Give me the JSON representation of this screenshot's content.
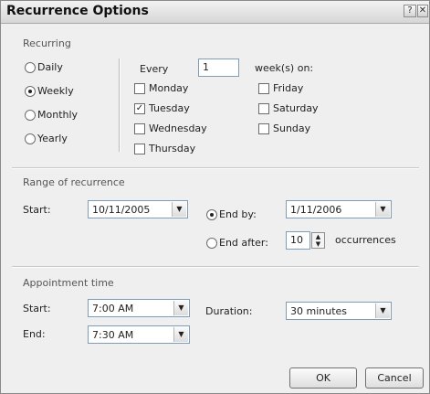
{
  "window": {
    "title": "Recurrence Options",
    "help_glyph": "?",
    "close_glyph": "✕"
  },
  "recurring": {
    "group_label": "Recurring",
    "patterns": [
      {
        "label": "Daily",
        "selected": false
      },
      {
        "label": "Weekly",
        "selected": true
      },
      {
        "label": "Monthly",
        "selected": false
      },
      {
        "label": "Yearly",
        "selected": false
      }
    ],
    "every_label": "Every",
    "every_value": "1",
    "weeks_on_label": "week(s) on:",
    "days": [
      {
        "label": "Monday",
        "checked": false
      },
      {
        "label": "Tuesday",
        "checked": true
      },
      {
        "label": "Wednesday",
        "checked": false
      },
      {
        "label": "Thursday",
        "checked": false
      },
      {
        "label": "Friday",
        "checked": false
      },
      {
        "label": "Saturday",
        "checked": false
      },
      {
        "label": "Sunday",
        "checked": false
      }
    ]
  },
  "range": {
    "group_label": "Range of recurrence",
    "start_label": "Start:",
    "start_value": "10/11/2005",
    "end_by_label": "End by:",
    "end_by_value": "1/11/2006",
    "end_by_selected": true,
    "end_after_label": "End after:",
    "end_after_value": "10",
    "end_after_selected": false,
    "occurrences_label": "occurrences"
  },
  "appointment": {
    "group_label": "Appointment time",
    "start_label": "Start:",
    "start_value": "7:00 AM",
    "end_label": "End:",
    "end_value": "7:30 AM",
    "duration_label": "Duration:",
    "duration_value": "30 minutes"
  },
  "buttons": {
    "ok": "OK",
    "cancel": "Cancel"
  },
  "icons": {
    "dropdown": "chevron-down-icon",
    "spin_up": "caret-up-icon",
    "spin_down": "caret-down-icon",
    "check": "checkmark-icon"
  }
}
